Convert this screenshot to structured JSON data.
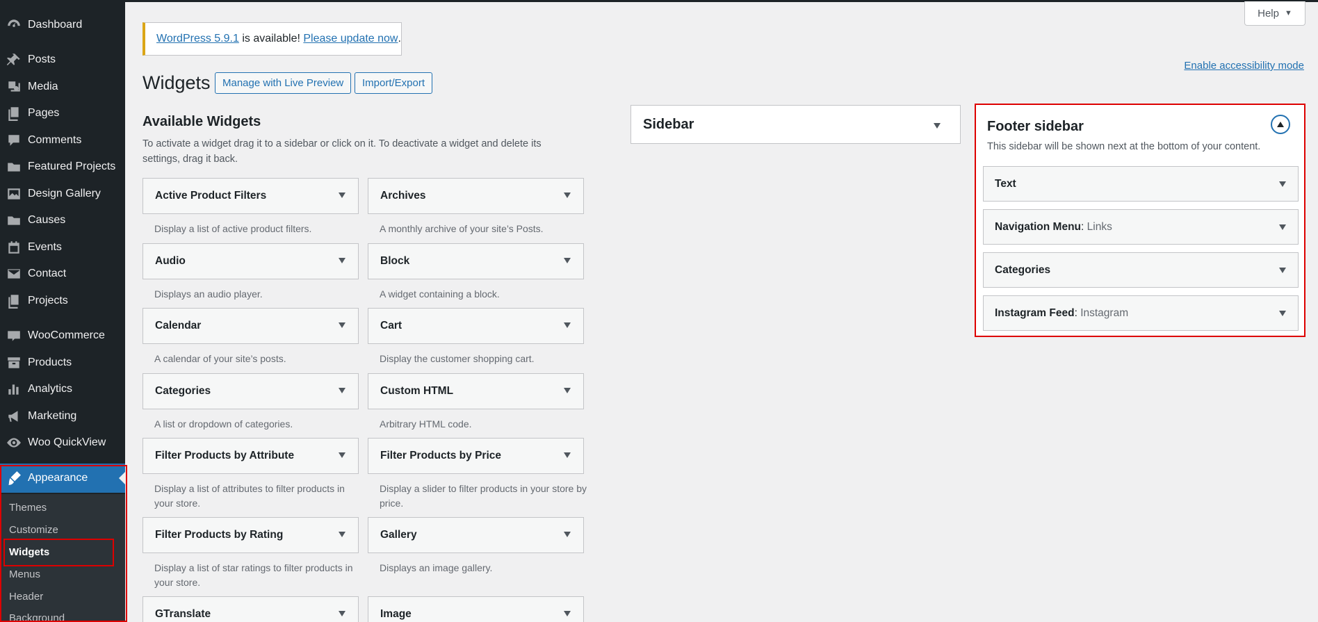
{
  "menu": [
    {
      "label": "Dashboard",
      "icon": "dashboard-icon"
    },
    {
      "label": "Posts",
      "icon": "pin-icon"
    },
    {
      "label": "Media",
      "icon": "media-icon"
    },
    {
      "label": "Pages",
      "icon": "pages-icon"
    },
    {
      "label": "Comments",
      "icon": "comment-icon"
    },
    {
      "label": "Featured Projects",
      "icon": "folder-icon"
    },
    {
      "label": "Design Gallery",
      "icon": "gallery-icon"
    },
    {
      "label": "Causes",
      "icon": "folder-icon"
    },
    {
      "label": "Events",
      "icon": "calendar-icon"
    },
    {
      "label": "Contact",
      "icon": "mail-icon"
    },
    {
      "label": "Projects",
      "icon": "projects-icon"
    },
    {
      "label": "WooCommerce",
      "icon": "woo-icon"
    },
    {
      "label": "Products",
      "icon": "archive-icon"
    },
    {
      "label": "Analytics",
      "icon": "chart-bar-icon"
    },
    {
      "label": "Marketing",
      "icon": "megaphone-icon"
    },
    {
      "label": "Woo QuickView",
      "icon": "eye-icon"
    },
    {
      "label": "Appearance",
      "icon": "brush-icon"
    }
  ],
  "submenu": [
    "Themes",
    "Customize",
    "Widgets",
    "Menus",
    "Header",
    "Background"
  ],
  "help": "Help",
  "notice": {
    "link1": "WordPress 5.9.1",
    "text": " is available! ",
    "link2": "Please update now",
    "end": "."
  },
  "a11y_link": "Enable accessibility mode",
  "page_title": "Widgets",
  "buttons": {
    "live_preview": "Manage with Live Preview",
    "import_export": "Import/Export"
  },
  "available": {
    "title": "Available Widgets",
    "desc": "To activate a widget drag it to a sidebar or click on it. To deactivate a widget and delete its settings, drag it back."
  },
  "widgets_left": [
    {
      "title": "Active Product Filters",
      "desc": "Display a list of active product filters."
    },
    {
      "title": "Audio",
      "desc": "Displays an audio player."
    },
    {
      "title": "Calendar",
      "desc": "A calendar of your site’s posts."
    },
    {
      "title": "Categories",
      "desc": "A list or dropdown of categories."
    },
    {
      "title": "Filter Products by Attribute",
      "desc": "Display a list of attributes to filter products in your store."
    },
    {
      "title": "Filter Products by Rating",
      "desc": "Display a list of star ratings to filter products in your store."
    },
    {
      "title": "GTranslate",
      "desc": ""
    }
  ],
  "widgets_right": [
    {
      "title": "Archives",
      "desc": "A monthly archive of your site’s Posts."
    },
    {
      "title": "Block",
      "desc": "A widget containing a block."
    },
    {
      "title": "Cart",
      "desc": "Display the customer shopping cart."
    },
    {
      "title": "Custom HTML",
      "desc": "Arbitrary HTML code."
    },
    {
      "title": "Filter Products by Price",
      "desc": "Display a slider to filter products in your store by price."
    },
    {
      "title": "Gallery",
      "desc": "Displays an image gallery."
    },
    {
      "title": "Image",
      "desc": ""
    }
  ],
  "sidebar": {
    "title": "Sidebar"
  },
  "footer_sidebar": {
    "title": "Footer sidebar",
    "desc": "This sidebar will be shown next at the bottom of your content.",
    "widgets": [
      {
        "title": "Text",
        "sub": ""
      },
      {
        "title": "Navigation Menu",
        "sub": "Links"
      },
      {
        "title": "Categories",
        "sub": ""
      },
      {
        "title": "Instagram Feed",
        "sub": "Instagram"
      }
    ]
  }
}
